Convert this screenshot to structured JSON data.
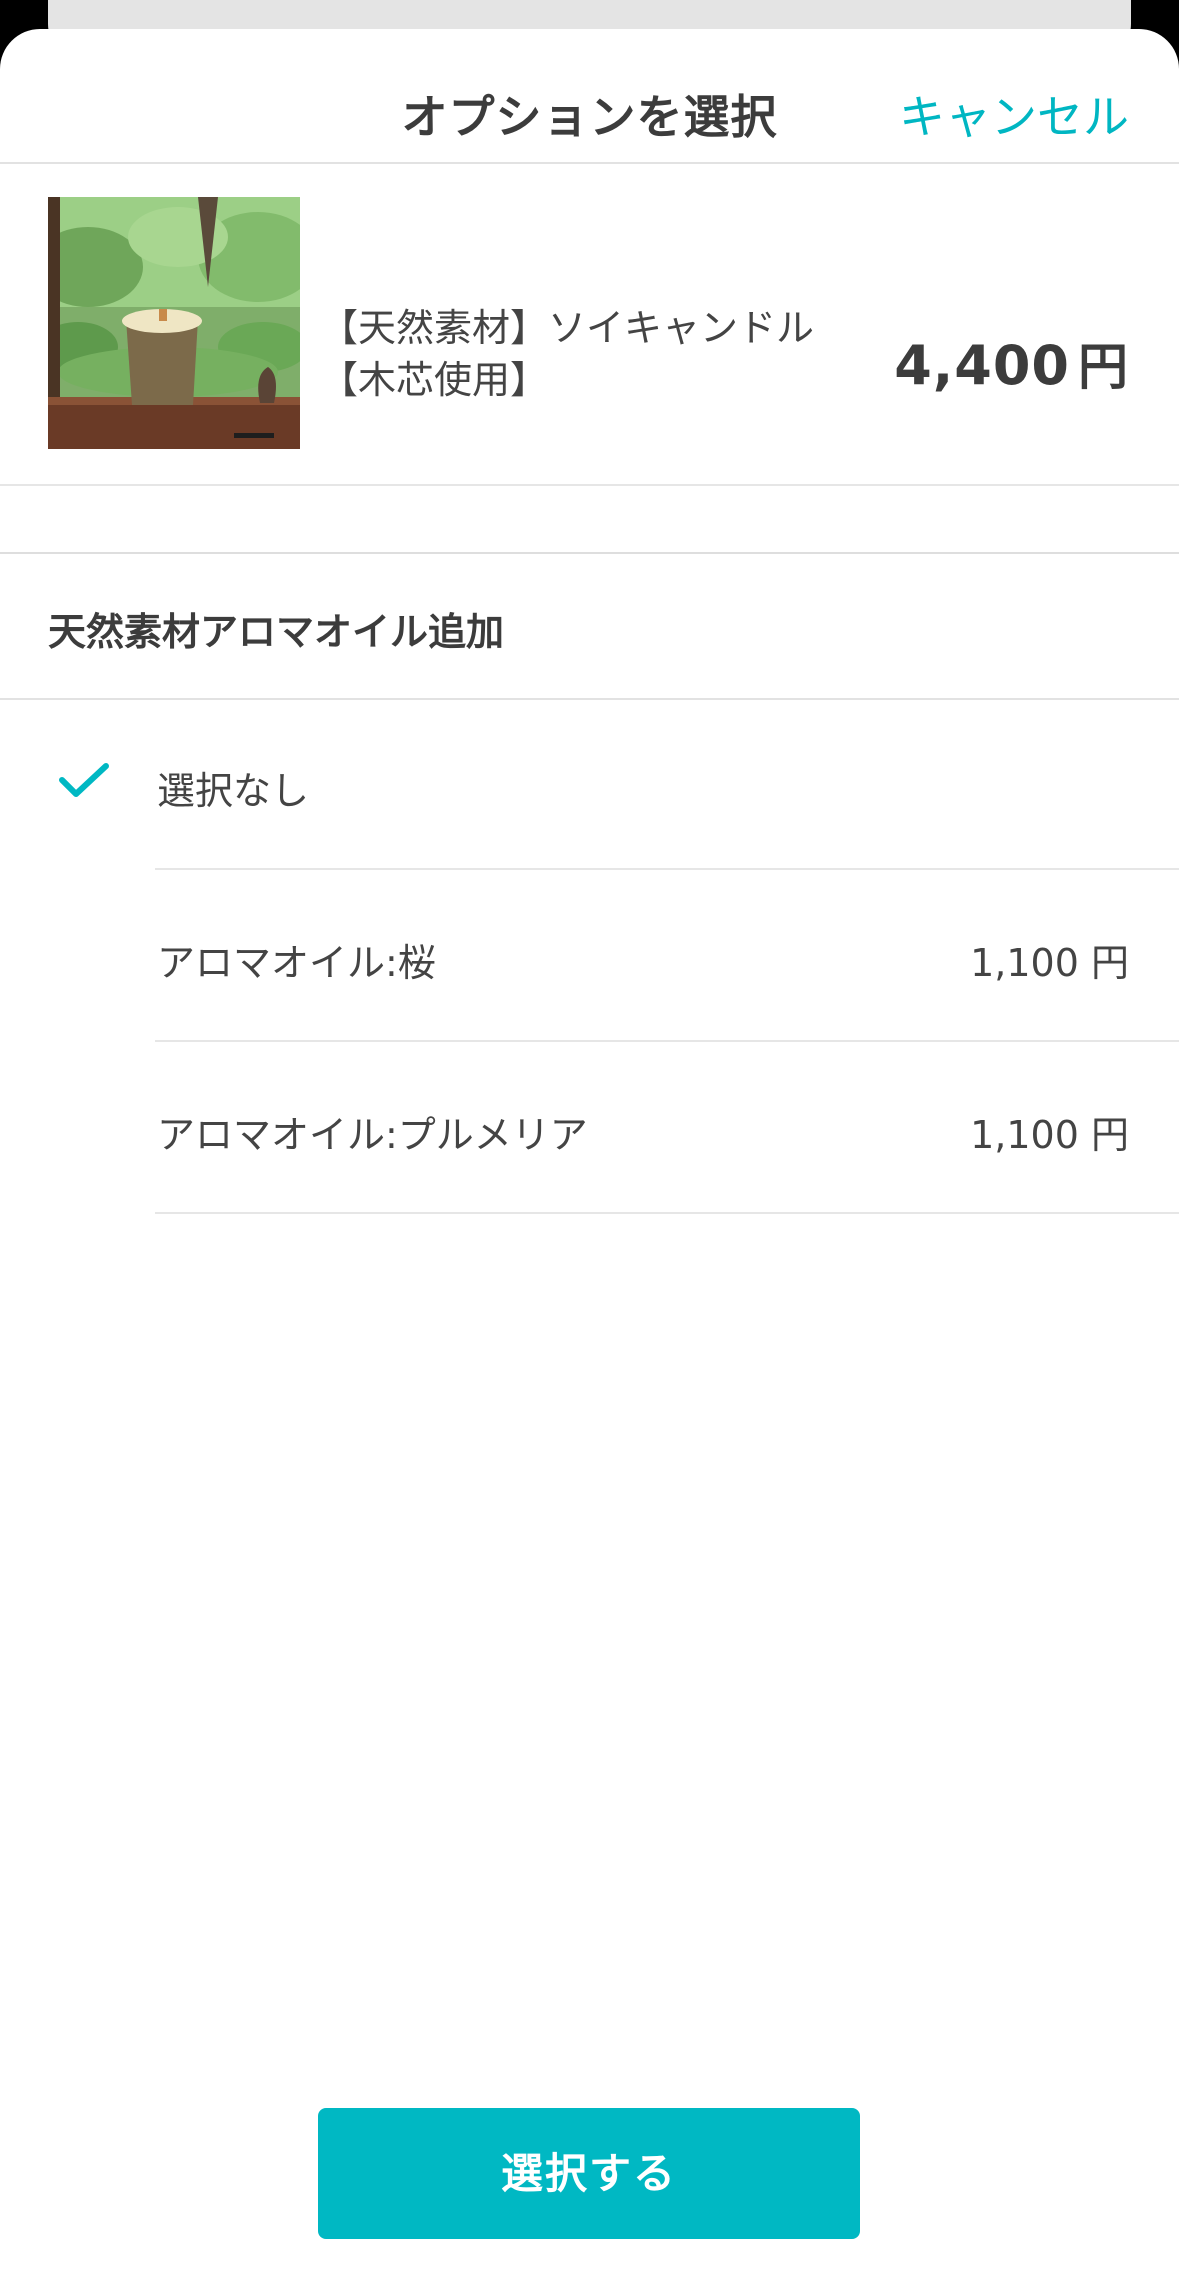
{
  "header": {
    "title": "オプションを選択",
    "cancel_label": "キャンセル"
  },
  "product": {
    "name_line1": "【天然素材】ソイキャンドル",
    "name_line2": "【木芯使用】",
    "price": "4,400",
    "currency": "円"
  },
  "section": {
    "title": "天然素材アロマオイル追加"
  },
  "options": [
    {
      "label": "選択なし",
      "price": "",
      "selected": true
    },
    {
      "label": "アロマオイル:桜",
      "price": "1,100 円",
      "selected": false
    },
    {
      "label": "アロマオイル:プルメリア",
      "price": "1,100 円",
      "selected": false
    }
  ],
  "footer": {
    "select_label": "選択する"
  },
  "colors": {
    "accent": "#00b8c3",
    "text": "#3c3c3c"
  }
}
